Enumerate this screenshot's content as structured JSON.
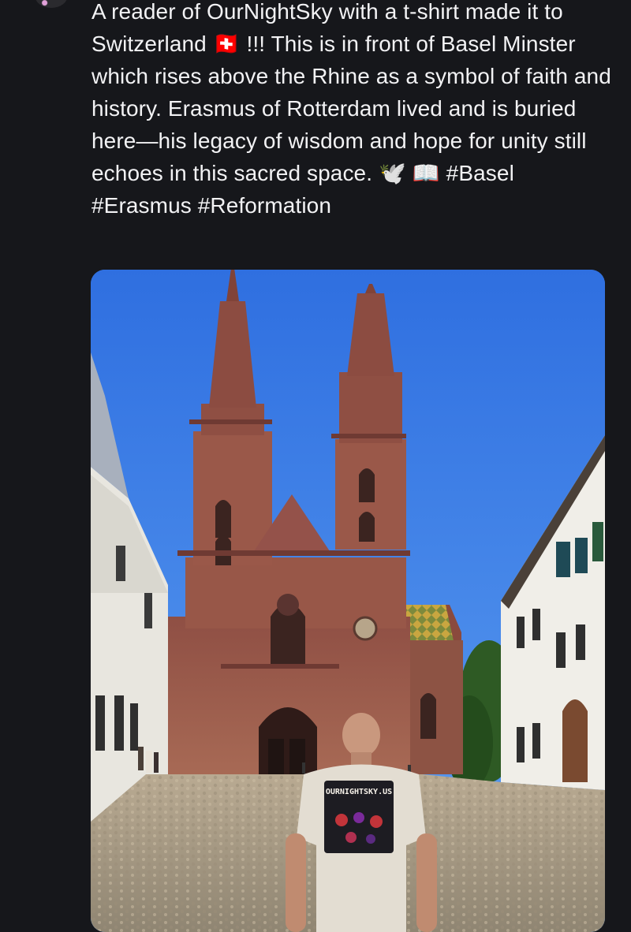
{
  "post": {
    "text": "A reader of OurNightSky with a t-shirt made it to Switzerland 🇨🇭 !!! This is in front of Basel Minster which rises above the Rhine as a symbol of faith and history. Erasmus of Rotterdam lived and is buried here—his legacy of wisdom and hope for unity still echoes in this sacred space. 🕊️ 📖 #Basel #Erasmus #Reformation"
  },
  "photo": {
    "shirt_print": "OURNIGHTSKY.US"
  },
  "colors": {
    "background": "#16171b",
    "text": "#f2f2f4",
    "sky": "#3c7fe6",
    "sandstone": "#9c5a4a"
  }
}
